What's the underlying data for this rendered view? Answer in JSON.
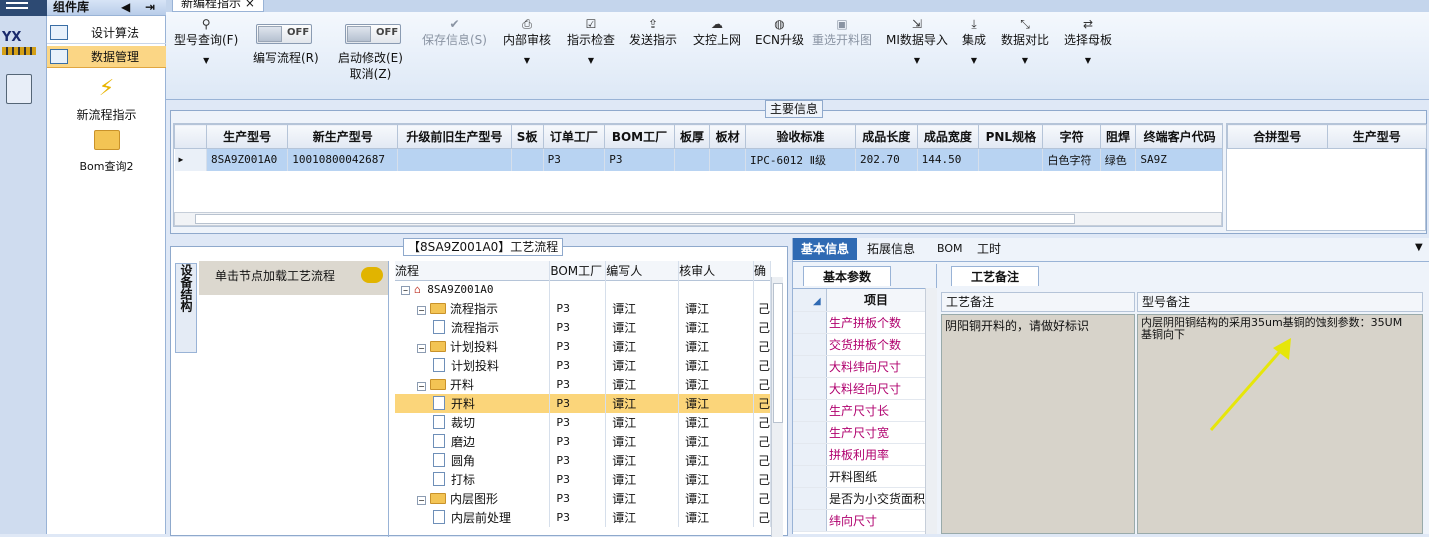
{
  "colors": {
    "accent": "#2f6ab3",
    "selected": "#fbd57a",
    "param_name": "#b0006e"
  },
  "left_panel": {
    "title": "组件库",
    "items": [
      {
        "label": "设计算法",
        "icon": "table-icon"
      },
      {
        "label": "数据管理",
        "icon": "table-icon"
      }
    ],
    "big_items": [
      {
        "label": "新流程指示",
        "icon": "lightning-icon"
      },
      {
        "label": "Bom查询2",
        "icon": "folder-icon"
      }
    ]
  },
  "window_tab": "新编程指示",
  "toolbar": {
    "type_query": "型号查询(F)",
    "write_flow": "编写流程(R)",
    "start_edit": "启动修改(E)",
    "cancel": "取消(Z)",
    "toggle_off": "OFF",
    "save_info": "保存信息(S)",
    "internal_review": "内部审核",
    "directive_check": "指示检查",
    "send_directive": "发送指示",
    "upload": "文控上网",
    "ecn": "ECN升级",
    "reselect": "重选开料图",
    "mi_import": "MI数据导入",
    "integrate": "集成",
    "compare": "数据对比",
    "select_parent": "选择母板"
  },
  "main_info": {
    "legend": "主要信息",
    "columns": [
      "生产型号",
      "新生产型号",
      "升级前旧生产型号",
      "S板",
      "订单工厂",
      "BOM工厂",
      "板厚",
      "板材",
      "验收标准",
      "成品长度",
      "成品宽度",
      "PNL规格",
      "字符",
      "阻焊",
      "终端客户代码"
    ],
    "row": [
      "8SA9Z001A0",
      "10010800042687",
      "",
      "",
      "P3",
      "P3",
      "",
      "",
      "IPC-6012 Ⅱ级",
      "202.70",
      "144.50",
      "",
      "白色字符",
      "绿色",
      "SA9Z"
    ],
    "side_columns": [
      "合拼型号",
      "生产型号"
    ]
  },
  "process": {
    "legend": "【8SA9Z001A0】工艺流程",
    "side_label": "设备结构",
    "hint": "单击节点加载工艺流程",
    "columns": [
      "流程",
      "BOM工厂",
      "编写人",
      "核审人",
      "确"
    ],
    "root": "8SA9Z001A0",
    "rows": [
      {
        "name": "流程指示",
        "level": 1,
        "type": "folder",
        "bom": "P3",
        "writer": "谭江",
        "reviewer": "谭江",
        "c": "己"
      },
      {
        "name": "流程指示",
        "level": 2,
        "type": "doc",
        "bom": "P3",
        "writer": "谭江",
        "reviewer": "谭江",
        "c": "己"
      },
      {
        "name": "计划投料",
        "level": 1,
        "type": "folder",
        "bom": "P3",
        "writer": "谭江",
        "reviewer": "谭江",
        "c": "己"
      },
      {
        "name": "计划投料",
        "level": 2,
        "type": "doc",
        "bom": "P3",
        "writer": "谭江",
        "reviewer": "谭江",
        "c": "己"
      },
      {
        "name": "开料",
        "level": 1,
        "type": "folder",
        "bom": "P3",
        "writer": "谭江",
        "reviewer": "谭江",
        "c": "己"
      },
      {
        "name": "开料",
        "level": 2,
        "type": "doc",
        "bom": "P3",
        "writer": "谭江",
        "reviewer": "谭江",
        "c": "己",
        "selected": true
      },
      {
        "name": "裁切",
        "level": 2,
        "type": "doc",
        "bom": "P3",
        "writer": "谭江",
        "reviewer": "谭江",
        "c": "己"
      },
      {
        "name": "磨边",
        "level": 2,
        "type": "doc",
        "bom": "P3",
        "writer": "谭江",
        "reviewer": "谭江",
        "c": "己"
      },
      {
        "name": "圆角",
        "level": 2,
        "type": "doc",
        "bom": "P3",
        "writer": "谭江",
        "reviewer": "谭江",
        "c": "己"
      },
      {
        "name": "打标",
        "level": 2,
        "type": "doc",
        "bom": "P3",
        "writer": "谭江",
        "reviewer": "谭江",
        "c": "己"
      },
      {
        "name": "内层图形",
        "level": 1,
        "type": "folder",
        "bom": "P3",
        "writer": "谭江",
        "reviewer": "谭江",
        "c": "己"
      },
      {
        "name": "内层前处理",
        "level": 2,
        "type": "doc",
        "bom": "P3",
        "writer": "谭江",
        "reviewer": "谭江",
        "c": "己"
      }
    ]
  },
  "detail": {
    "tabs": [
      "基本信息",
      "拓展信息",
      "BOM",
      "工时"
    ],
    "subtab": "基本参数",
    "param_header": "项目",
    "params": [
      "生产拼板个数",
      "交货拼板个数",
      "大料纬向尺寸",
      "大料经向尺寸",
      "生产尺寸长",
      "生产尺寸宽",
      "拼板利用率",
      "开料图纸",
      "是否为小交货面积",
      "纬向尺寸"
    ],
    "remarks_tab": "工艺备注",
    "remarks_header": "工艺备注",
    "remarks_text": "阴阳铜开料的，请做好标识",
    "model_header": "型号备注",
    "model_text": "内层阴阳铜结构的采用35um基铜的蚀刻参数：35UM基铜向下"
  }
}
